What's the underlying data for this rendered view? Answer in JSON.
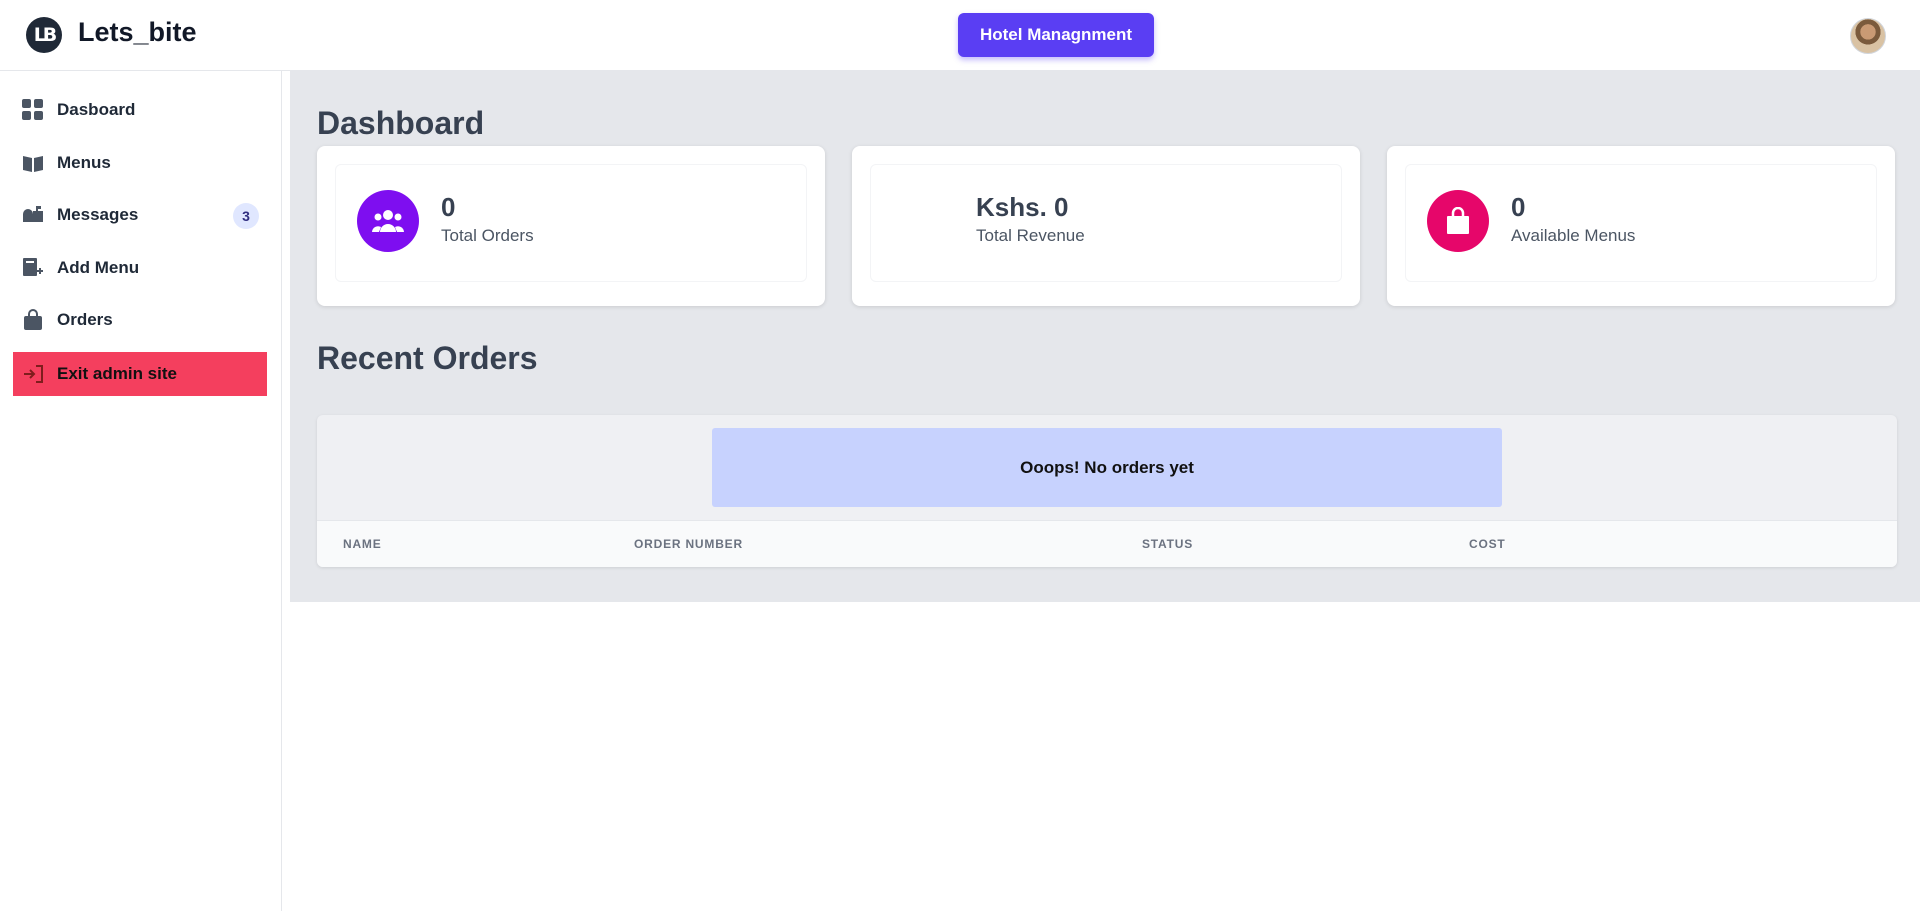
{
  "header": {
    "logo_text": "LB",
    "brand": "Lets_bite",
    "center_button": "Hotel Managnment",
    "avatar_icon": "user-avatar"
  },
  "sidebar": {
    "items": [
      {
        "label": "Dasboard",
        "icon": "grid-icon"
      },
      {
        "label": "Menus",
        "icon": "book-open-icon"
      },
      {
        "label": "Messages",
        "icon": "mailbox-icon",
        "badge": "3"
      },
      {
        "label": "Add Menu",
        "icon": "book-plus-icon"
      },
      {
        "label": "Orders",
        "icon": "shopping-bag-icon"
      },
      {
        "label": "Exit admin site",
        "icon": "sign-out-icon"
      }
    ]
  },
  "main": {
    "title": "Dashboard",
    "cards": [
      {
        "value": "0",
        "label": "Total Orders",
        "icon": "users-icon",
        "color": "#7e0ef0"
      },
      {
        "value": "Kshs. 0",
        "label": "Total Revenue",
        "icon": "",
        "color": ""
      },
      {
        "value": "0",
        "label": "Available Menus",
        "icon": "shopping-bag-icon",
        "color": "#e6066a"
      }
    ],
    "recent_title": "Recent Orders",
    "empty_message": "Ooops! No orders yet",
    "columns": [
      "NAME",
      "ORDER NUMBER",
      "STATUS",
      "COST"
    ]
  },
  "colors": {
    "accent": "#5a3ef3",
    "exit": "#f43f5e",
    "main_bg": "#e5e7eb",
    "empty_alert": "#c7d2fe"
  }
}
